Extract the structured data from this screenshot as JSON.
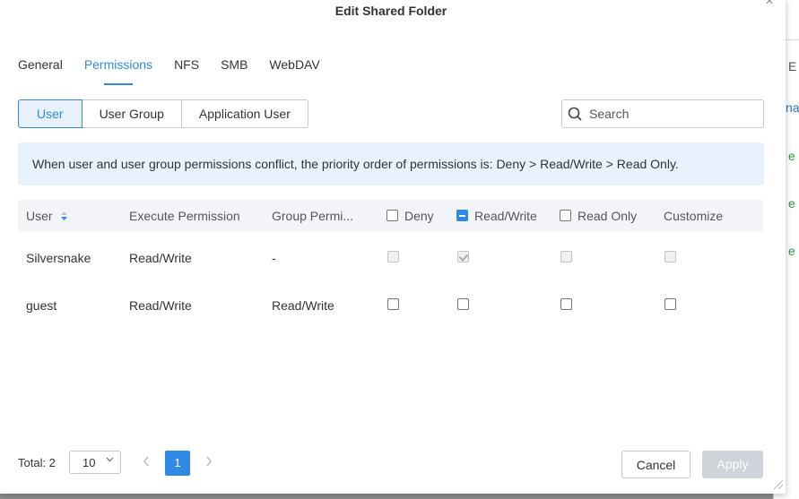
{
  "dialog": {
    "title": "Edit Shared Folder",
    "close_glyph": "×"
  },
  "tabs": [
    {
      "label": "General",
      "active": false
    },
    {
      "label": "Permissions",
      "active": true
    },
    {
      "label": "NFS",
      "active": false
    },
    {
      "label": "SMB",
      "active": false
    },
    {
      "label": "WebDAV",
      "active": false
    }
  ],
  "segments": [
    {
      "label": "User",
      "active": true
    },
    {
      "label": "User Group",
      "active": false
    },
    {
      "label": "Application User",
      "active": false
    }
  ],
  "search": {
    "placeholder": "Search",
    "value": ""
  },
  "notice": "When user and user group permissions conflict, the priority order of permissions is: Deny > Read/Write > Read Only.",
  "table": {
    "headers": {
      "user": "User",
      "execute": "Execute Permission",
      "group": "Group Permi...",
      "deny": "Deny",
      "readwrite": "Read/Write",
      "readonly": "Read Only",
      "customize": "Customize"
    },
    "header_state": {
      "deny": "unchecked",
      "readwrite": "indeterminate",
      "readonly": "unchecked"
    },
    "rows": [
      {
        "user": "Silversnake",
        "execute": "Read/Write",
        "group": "-",
        "deny": "disabled",
        "readwrite": "checked-disabled",
        "readonly": "disabled",
        "customize": "disabled"
      },
      {
        "user": "guest",
        "execute": "Read/Write",
        "group": "Read/Write",
        "deny": "unchecked",
        "readwrite": "unchecked",
        "readonly": "unchecked",
        "customize": "unchecked"
      }
    ]
  },
  "footer": {
    "total": "Total: 2",
    "page_size": "10",
    "current_page": "1",
    "cancel": "Cancel",
    "apply": "Apply"
  },
  "colors": {
    "accent": "#2f8ae5",
    "notice_bg": "#e8f2fd",
    "apply_disabled": "#cfd4da"
  },
  "background_window": {
    "chars": [
      "E",
      "na",
      "e",
      "e",
      "e"
    ]
  }
}
